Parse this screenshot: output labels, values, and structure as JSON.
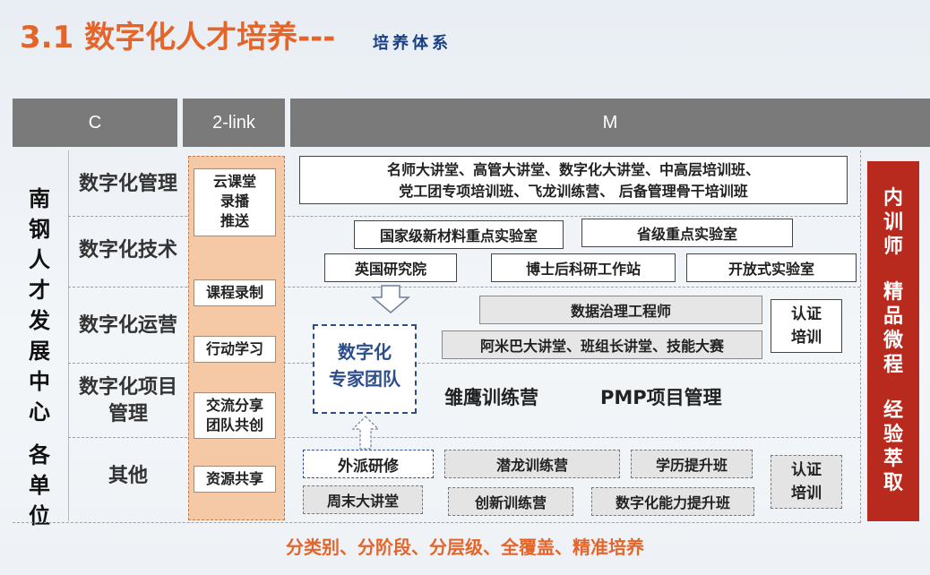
{
  "title": {
    "main": "3.1 数字化人才培养---",
    "sub": "培养体系"
  },
  "header": {
    "c": "C",
    "two_link": "2-link",
    "m": "M"
  },
  "left": {
    "text": "南钢人才发展中心 各单位"
  },
  "categories": {
    "mgmt": "数字化管理",
    "tech": "数字化技术",
    "ops": "数字化运营",
    "proj_line1": "数字化项目",
    "proj_line2": "管理",
    "other": "其他"
  },
  "two_link": {
    "cloud_l1": "云课堂",
    "cloud_l2": "录播",
    "cloud_l3": "推送",
    "recording": "课程录制",
    "action": "行动学习",
    "exchange_l1": "交流分享",
    "exchange_l2": "团队共创",
    "resource": "资源共享"
  },
  "m": {
    "names_l1": "名师大讲堂、高管大讲堂、数字化大讲堂、中高层培训班、",
    "names_l2": "党工团专项培训班、飞龙训练营、 后备管理骨干培训班",
    "lab_national": "国家级新材料重点实验室",
    "lab_provincial": "省级重点实验室",
    "uk_institute": "英国研究院",
    "postdoc": "博士后科研工作站",
    "open_lab": "开放式实验室",
    "data_gov": "数据治理工程师",
    "cert1_l1": "认证",
    "cert1_l2": "培训",
    "amoeba": "阿米巴大讲堂、班组长讲堂、技能大赛",
    "expert_l1": "数字化",
    "expert_l2": "专家团队",
    "eagle": "雏鹰训练营",
    "pmp": "PMP项目管理",
    "external": "外派研修",
    "qianlong": "潜龙训练营",
    "degree": "学历提升班",
    "cert2_l1": "认证",
    "cert2_l2": "培训",
    "weekend": "周末大讲堂",
    "innovation": "创新训练营",
    "digital_ability": "数字化能力提升班"
  },
  "right": {
    "inner": "内训师",
    "micro": "精品微程",
    "exp": "经验萃取"
  },
  "footer": "分类别、分阶段、分层级、全覆盖、精准培养",
  "colors": {
    "title_orange": "#e4652a",
    "title_blue": "#1a3f86",
    "header_gray": "#7a7a7a",
    "two_link_fill": "#f6c9a6",
    "right_red": "#b82a1d"
  }
}
